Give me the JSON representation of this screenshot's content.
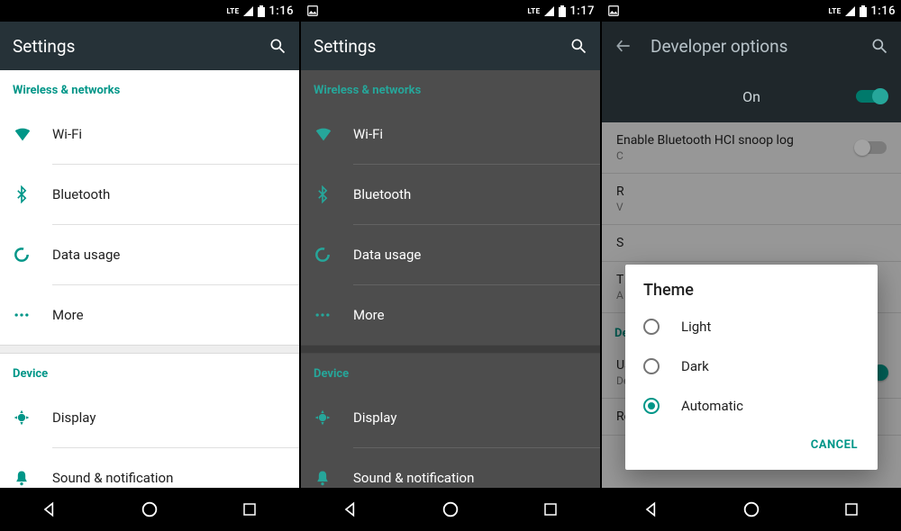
{
  "colors": {
    "teal": "#009688",
    "tealLight": "#26a69a"
  },
  "panels": [
    {
      "status": {
        "indicators": [
          "lte",
          "signal",
          "battery"
        ],
        "time": "1:16",
        "leftIcons": []
      },
      "appbar": {
        "title": "Settings"
      },
      "sections": [
        {
          "title": "Wireless & networks",
          "items": [
            {
              "icon": "wifi-icon",
              "label": "Wi-Fi"
            },
            {
              "icon": "bluetooth-icon",
              "label": "Bluetooth"
            },
            {
              "icon": "data-usage-icon",
              "label": "Data usage"
            },
            {
              "icon": "more-icon",
              "label": "More"
            }
          ]
        },
        {
          "title": "Device",
          "items": [
            {
              "icon": "display-icon",
              "label": "Display"
            },
            {
              "icon": "sound-icon",
              "label": "Sound & notification"
            }
          ]
        }
      ]
    },
    {
      "status": {
        "indicators": [
          "lte",
          "signal",
          "battery"
        ],
        "time": "1:17",
        "leftIcons": [
          "image-icon"
        ]
      },
      "appbar": {
        "title": "Settings"
      },
      "sections": [
        {
          "title": "Wireless & networks",
          "items": [
            {
              "icon": "wifi-icon",
              "label": "Wi-Fi"
            },
            {
              "icon": "bluetooth-icon",
              "label": "Bluetooth"
            },
            {
              "icon": "data-usage-icon",
              "label": "Data usage"
            },
            {
              "icon": "more-icon",
              "label": "More"
            }
          ]
        },
        {
          "title": "Device",
          "items": [
            {
              "icon": "display-icon",
              "label": "Display"
            },
            {
              "icon": "sound-icon",
              "label": "Sound & notification"
            }
          ]
        }
      ]
    },
    {
      "status": {
        "indicators": [
          "lte",
          "signal",
          "battery"
        ],
        "time": "1:16",
        "leftIcons": [
          "image-icon"
        ]
      },
      "appbar": {
        "title": "Developer options",
        "back": true
      },
      "onRow": {
        "label": "On",
        "enabled": true
      },
      "devItems": [
        {
          "name": "Enable Bluetooth HCI snoop log",
          "sub": "C",
          "toggle": "off"
        },
        {
          "name": "R",
          "sub": "V"
        },
        {
          "name": "S"
        },
        {
          "name": "T",
          "sub": "A"
        }
      ],
      "sectionTitle": "Debugging",
      "devItems2": [
        {
          "name": "USB debugging",
          "sub": "Debug mode when USB is connected",
          "toggle": "on"
        },
        {
          "name": "Revoke USB debugging authorizations"
        }
      ],
      "dialog": {
        "title": "Theme",
        "options": [
          {
            "label": "Light",
            "selected": false
          },
          {
            "label": "Dark",
            "selected": false
          },
          {
            "label": "Automatic",
            "selected": true
          }
        ],
        "cancel": "CANCEL"
      }
    }
  ]
}
